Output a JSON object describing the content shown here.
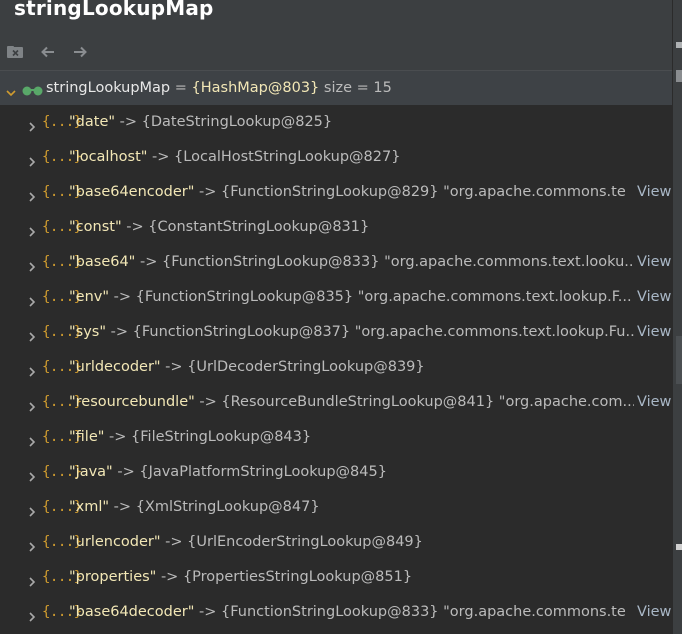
{
  "header": {
    "title": "stringLookupMap"
  },
  "toolbar": {
    "buttons": [
      {
        "icon": "close-tab-icon"
      },
      {
        "icon": "back-arrow-icon"
      },
      {
        "icon": "forward-arrow-icon"
      }
    ]
  },
  "root": {
    "name": "stringLookupMap",
    "equals": " = ",
    "value": "{HashMap@803}",
    "size": "  size = 15"
  },
  "entries": [
    {
      "icon_text": "{...}",
      "key": "\"date\"",
      "arrow": " -> ",
      "value": "{DateStringLookup@825}",
      "extra": "",
      "view": ""
    },
    {
      "icon_text": "{...}",
      "key": "\"localhost\"",
      "arrow": " -> ",
      "value": "{LocalHostStringLookup@827}",
      "extra": "",
      "view": ""
    },
    {
      "icon_text": "{...}",
      "key": "\"base64encoder\"",
      "arrow": " -> ",
      "value": "{FunctionStringLookup@829}",
      "extra": " \"org.apache.commons.te",
      "view": "View"
    },
    {
      "icon_text": "{...}",
      "key": "\"const\"",
      "arrow": " -> ",
      "value": "{ConstantStringLookup@831}",
      "extra": "",
      "view": ""
    },
    {
      "icon_text": "{...}",
      "key": "\"base64\"",
      "arrow": " -> ",
      "value": "{FunctionStringLookup@833}",
      "extra": " \"org.apache.commons.text.looku...",
      "view": "View"
    },
    {
      "icon_text": "{...}",
      "key": "\"env\"",
      "arrow": " -> ",
      "value": "{FunctionStringLookup@835}",
      "extra": " \"org.apache.commons.text.lookup.F...",
      "view": "View"
    },
    {
      "icon_text": "{...}",
      "key": "\"sys\"",
      "arrow": " -> ",
      "value": "{FunctionStringLookup@837}",
      "extra": " \"org.apache.commons.text.lookup.Fu...",
      "view": "View"
    },
    {
      "icon_text": "{...}",
      "key": "\"urldecoder\"",
      "arrow": " -> ",
      "value": "{UrlDecoderStringLookup@839}",
      "extra": "",
      "view": ""
    },
    {
      "icon_text": "{...}",
      "key": "\"resourcebundle\"",
      "arrow": " -> ",
      "value": "{ResourceBundleStringLookup@841}",
      "extra": " \"org.apache.com...",
      "view": "View"
    },
    {
      "icon_text": "{...}",
      "key": "\"file\"",
      "arrow": " -> ",
      "value": "{FileStringLookup@843}",
      "extra": "",
      "view": ""
    },
    {
      "icon_text": "{...}",
      "key": "\"java\"",
      "arrow": " -> ",
      "value": "{JavaPlatformStringLookup@845}",
      "extra": "",
      "view": ""
    },
    {
      "icon_text": "{...}",
      "key": "\"xml\"",
      "arrow": " -> ",
      "value": "{XmlStringLookup@847}",
      "extra": "",
      "view": ""
    },
    {
      "icon_text": "{...}",
      "key": "\"urlencoder\"",
      "arrow": " -> ",
      "value": "{UrlEncoderStringLookup@849}",
      "extra": "",
      "view": ""
    },
    {
      "icon_text": "{...}",
      "key": "\"properties\"",
      "arrow": " -> ",
      "value": "{PropertiesStringLookup@851}",
      "extra": "",
      "view": ""
    },
    {
      "icon_text": "{...}",
      "key": "\"base64decoder\"",
      "arrow": " -> ",
      "value": "{FunctionStringLookup@833}",
      "extra": " \"org.apache.commons.te",
      "view": "View"
    }
  ],
  "colors": {
    "background": "#2b2b2b",
    "panel": "#3c3f41",
    "selected_row": "#3e4246",
    "key": "#f2e7b6",
    "brace_icon": "#d09c2f",
    "watch_icon": "#59a869",
    "text": "#bbbbbb"
  }
}
